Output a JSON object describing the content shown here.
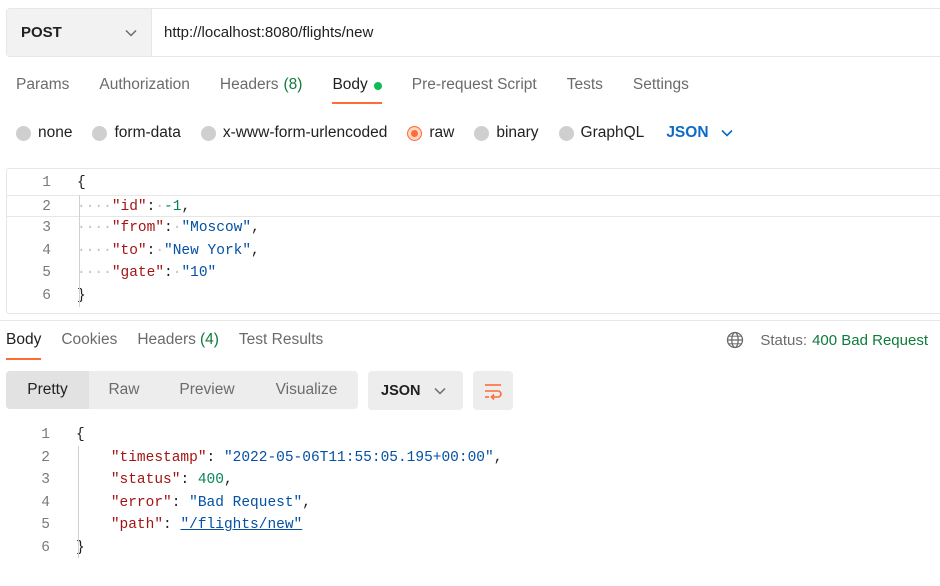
{
  "request": {
    "method": "POST",
    "url": "http://localhost:8080/flights/new",
    "tabs": [
      {
        "label": "Params",
        "count": ""
      },
      {
        "label": "Authorization",
        "count": ""
      },
      {
        "label": "Headers",
        "count": "(8)"
      },
      {
        "label": "Body",
        "count": ""
      },
      {
        "label": "Pre-request Script",
        "count": ""
      },
      {
        "label": "Tests",
        "count": ""
      },
      {
        "label": "Settings",
        "count": ""
      }
    ],
    "body_types": [
      "none",
      "form-data",
      "x-www-form-urlencoded",
      "raw",
      "binary",
      "GraphQL"
    ],
    "selected_body_type": "raw",
    "language": "JSON",
    "body_lines": [
      {
        "num": "1",
        "text": "{"
      },
      {
        "num": "2",
        "key": "\"id\"",
        "value": "-1",
        "value_type": "number",
        "trail": ","
      },
      {
        "num": "3",
        "key": "\"from\"",
        "value": "\"Moscow\"",
        "value_type": "string",
        "trail": ","
      },
      {
        "num": "4",
        "key": "\"to\"",
        "value": "\"New York\"",
        "value_type": "string",
        "trail": ","
      },
      {
        "num": "5",
        "key": "\"gate\"",
        "value": "\"10\"",
        "value_type": "string",
        "trail": ""
      },
      {
        "num": "6",
        "text": "}"
      }
    ]
  },
  "response": {
    "tabs": [
      {
        "label": "Body",
        "count": ""
      },
      {
        "label": "Cookies",
        "count": ""
      },
      {
        "label": "Headers",
        "count": "(4)"
      },
      {
        "label": "Test Results",
        "count": ""
      }
    ],
    "status_label": "Status:",
    "status_value": "400 Bad Request",
    "views": [
      "Pretty",
      "Raw",
      "Preview",
      "Visualize"
    ],
    "language": "JSON",
    "body_lines": [
      {
        "num": "1",
        "text": "{"
      },
      {
        "num": "2",
        "key": "\"timestamp\"",
        "value": "\"2022-05-06T11:55:05.195+00:00\"",
        "value_type": "string",
        "trail": ","
      },
      {
        "num": "3",
        "key": "\"status\"",
        "value": "400",
        "value_type": "number",
        "trail": ","
      },
      {
        "num": "4",
        "key": "\"error\"",
        "value": "\"Bad Request\"",
        "value_type": "string",
        "trail": ","
      },
      {
        "num": "5",
        "key": "\"path\"",
        "value": "\"/flights/new\"",
        "value_type": "link",
        "trail": ""
      },
      {
        "num": "6",
        "text": "}"
      }
    ]
  },
  "colors": {
    "accent": "#ff6c37",
    "success_green": "#0f7b3a",
    "link_blue": "#0d6bc5"
  },
  "icons": {
    "method_dropdown": "chevron-down-icon",
    "body_dot": "green-dot-icon",
    "globe": "globe-icon",
    "wrap": "wrap-lines-icon"
  }
}
